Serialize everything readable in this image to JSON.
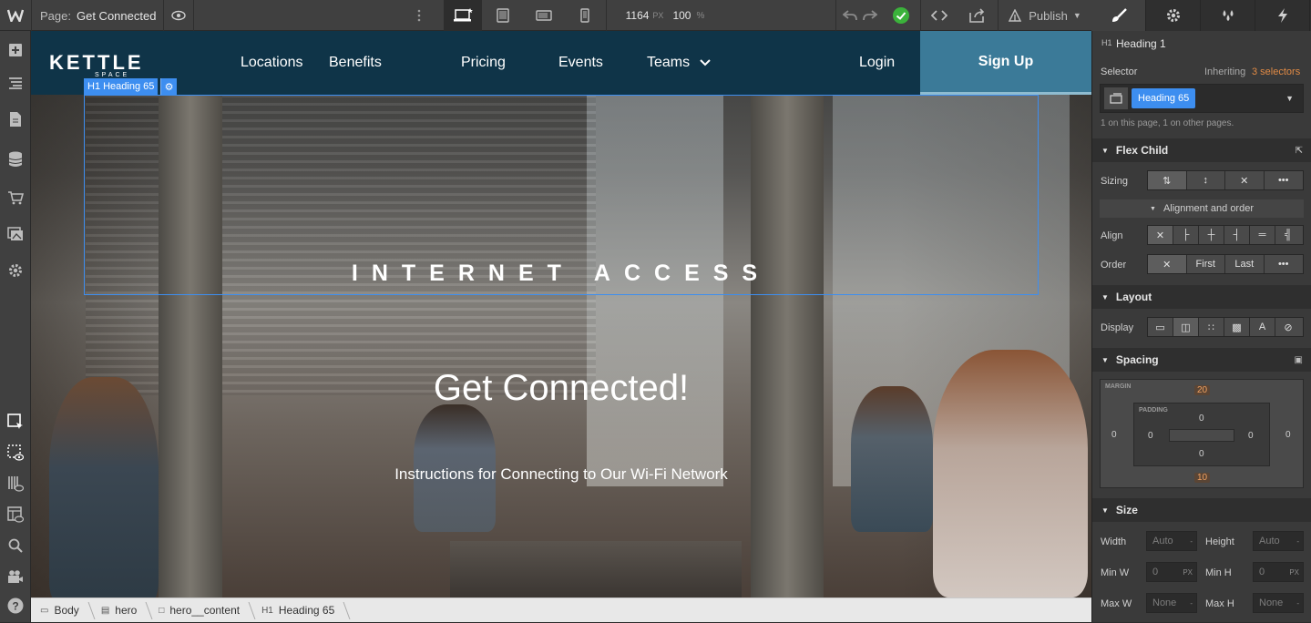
{
  "topbar": {
    "page_prefix": "Page:",
    "page_name": "Get Connected",
    "width_value": "1164",
    "width_unit": "PX",
    "zoom_value": "100",
    "zoom_unit": "%",
    "publish_label": "Publish"
  },
  "canvas": {
    "logo_text": "KETTLE",
    "logo_sub": "SPACE",
    "nav": [
      "Locations",
      "Benefits",
      "Pricing",
      "Events",
      "Teams"
    ],
    "login": "Login",
    "signup": "Sign Up",
    "selected_tag": "H1  Heading 65",
    "heading65": "INTERNET ACCESS",
    "hero_title": "Get Connected!",
    "hero_subtitle": "Instructions for Connecting to Our Wi-Fi Network"
  },
  "breadcrumbs": [
    "Body",
    "hero",
    "hero__content",
    "Heading 65"
  ],
  "breadcrumb_last_prefix": "H1",
  "panel": {
    "element_tag": "H1",
    "element_name": "Heading 1",
    "selector_label": "Selector",
    "inheriting_prefix": "Inheriting",
    "inheriting_count": "3 selectors",
    "selector_chip": "Heading 65",
    "selector_usage": "1 on this page, 1 on other pages.",
    "flex_child": "Flex Child",
    "sizing_label": "Sizing",
    "alignment_order": "Alignment and order",
    "align_label": "Align",
    "order_label": "Order",
    "order_first": "First",
    "order_last": "Last",
    "layout": "Layout",
    "display_label": "Display",
    "spacing": "Spacing",
    "margin_label": "MARGIN",
    "padding_label": "PADDING",
    "margin_top": "20",
    "margin_bottom": "10",
    "margin_left": "0",
    "margin_right": "0",
    "padding_top": "0",
    "padding_bottom": "0",
    "padding_left": "0",
    "padding_right": "0",
    "size": "Size",
    "width_label": "Width",
    "width_value": "Auto",
    "height_label": "Height",
    "height_value": "Auto",
    "minw_label": "Min W",
    "minw_value": "0",
    "minh_label": "Min H",
    "minh_value": "0",
    "maxw_label": "Max W",
    "maxw_value": "None",
    "maxh_label": "Max H",
    "maxh_value": "None",
    "px_unit": "PX",
    "dash": "-"
  },
  "colors": {
    "accent_blue": "#3d8ef0",
    "nav_bg": "#0f3448",
    "signup_bg": "#3b7a98",
    "selector_orange": "#e08a45"
  }
}
